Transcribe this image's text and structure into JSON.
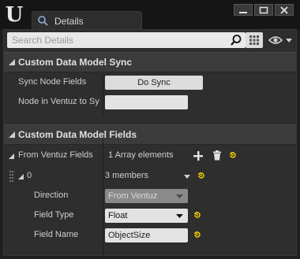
{
  "window": {
    "tab_title": "Details",
    "colors": {
      "background": "#1f1f1f",
      "panel": "#2e2e2e",
      "section": "#3b3b3b",
      "accent_yellow": "#f0d000"
    }
  },
  "search": {
    "placeholder": "Search Details",
    "value": ""
  },
  "sections": [
    {
      "title": "Custom Data Model Sync"
    },
    {
      "title": "Custom Data Model Fields"
    }
  ],
  "sync": {
    "sync_node_fields_label": "Sync Node Fields",
    "do_sync_label": "Do Sync",
    "node_in_ventuz_label": "Node in Ventuz to Sy",
    "node_in_ventuz_value": ""
  },
  "fields": {
    "from_ventuz_label": "From Ventuz Fields",
    "array_count": "1 Array elements",
    "element_index": "0",
    "element_members": "3 members",
    "direction_label": "Direction",
    "direction_value": "From Ventuz",
    "field_type_label": "Field Type",
    "field_type_value": "Float",
    "field_name_label": "Field Name",
    "field_name_value": "ObjectSize"
  },
  "icons": {
    "logo": "unreal-logo",
    "tab": "details-icon",
    "search": "search-icon",
    "view": "grid-icon",
    "visibility": "eye-icon",
    "add": "plus-icon",
    "delete": "trash-icon",
    "reset": "reset-arrow-icon"
  }
}
